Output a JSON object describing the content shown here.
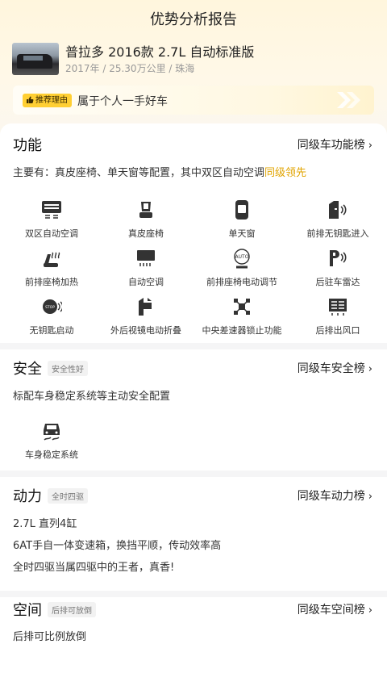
{
  "header": {
    "title": "优势分析报告"
  },
  "car": {
    "name": "普拉多 2016款 2.7L 自动标准版",
    "meta": "2017年 / 25.30万公里 / 珠海"
  },
  "reason": {
    "tag": "推荐理由",
    "text": "属于个人一手好车"
  },
  "features": {
    "title": "功能",
    "rank_link": "同级车功能榜",
    "summary": "主要有：真皮座椅、单天窗等配置，其中双区自动空调",
    "summary_highlight": "同级领先",
    "items": [
      {
        "label": "双区自动空调",
        "icon": "dual-zone-ac-icon"
      },
      {
        "label": "真皮座椅",
        "icon": "leather-seat-icon"
      },
      {
        "label": "单天窗",
        "icon": "sunroof-icon"
      },
      {
        "label": "前排无钥匙进入",
        "icon": "keyless-entry-icon"
      },
      {
        "label": "前排座椅加热",
        "icon": "seat-heating-icon"
      },
      {
        "label": "自动空调",
        "icon": "auto-ac-icon"
      },
      {
        "label": "前排座椅电动调节",
        "icon": "power-seat-icon"
      },
      {
        "label": "后驻车雷达",
        "icon": "parking-radar-icon"
      },
      {
        "label": "无钥匙启动",
        "icon": "keyless-start-icon"
      },
      {
        "label": "外后视镜电动折叠",
        "icon": "mirror-fold-icon"
      },
      {
        "label": "中央差速器锁止功能",
        "icon": "diff-lock-icon"
      },
      {
        "label": "后排出风口",
        "icon": "rear-vent-icon"
      }
    ]
  },
  "safety": {
    "title": "安全",
    "badge": "安全性好",
    "rank_link": "同级车安全榜",
    "summary": "标配车身稳定系统等主动安全配置",
    "items": [
      {
        "label": "车身稳定系统",
        "icon": "stability-control-icon"
      }
    ]
  },
  "power": {
    "title": "动力",
    "badge": "全时四驱",
    "rank_link": "同级车动力榜",
    "lines": [
      "2.7L 直列4缸",
      "6AT手自一体变速箱，换挡平顺，传动效率高",
      "全时四驱当属四驱中的王者，真香!"
    ]
  },
  "space": {
    "title": "空间",
    "badge": "后排可放倒",
    "rank_link": "同级车空间榜",
    "lines": [
      "后排可比例放倒"
    ]
  }
}
